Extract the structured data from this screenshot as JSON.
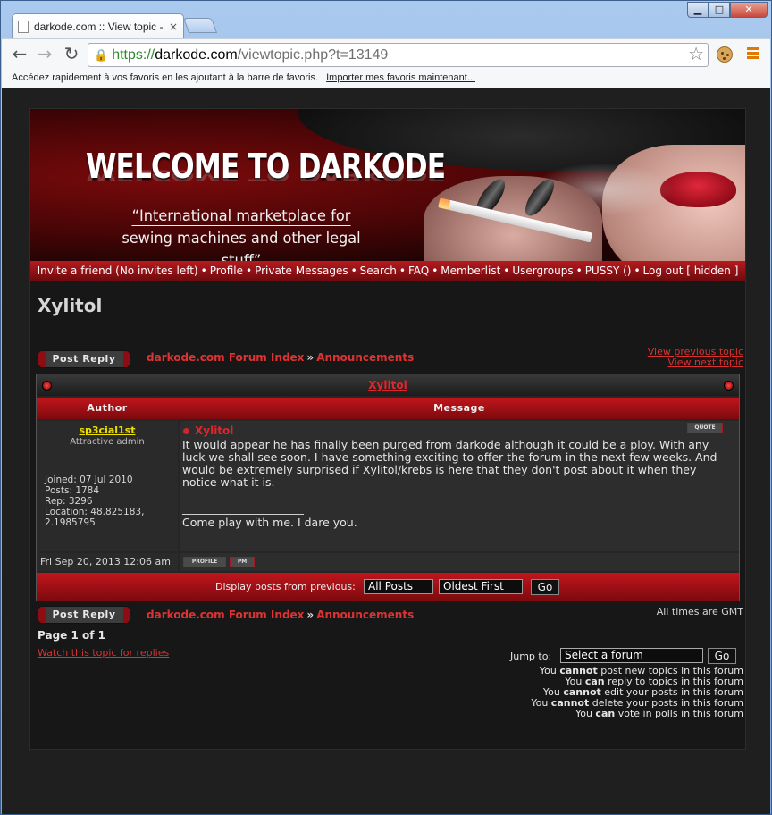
{
  "browser": {
    "tab_title": "darkode.com :: View topic - X",
    "tab_close": "×",
    "url_scheme": "https://",
    "url_host": "darkode.com",
    "url_path": "/viewtopic.php?t=13149",
    "bookmarks_bar_text": "Accédez rapidement à vos favoris en les ajoutant à la barre de favoris.",
    "bookmarks_import_link": "Importer mes favoris maintenant..."
  },
  "banner": {
    "welcome_text": "WELCOME TO DARKODE",
    "tagline_line1": "“International marketplace for",
    "tagline_line2": "sewing machines and other legal stuff”"
  },
  "topnav": {
    "items": [
      "Invite a friend (No invites left)",
      "Profile",
      "Private Messages",
      "Search",
      "FAQ",
      "Memberlist",
      "Usergroups",
      "PUSSY ()",
      "Log out [ hidden ]"
    ],
    "separator": "•"
  },
  "topic": {
    "heading": "Xylitol",
    "post_reply_label": "Post Reply",
    "breadcrumb_index": "darkode.com Forum Index",
    "breadcrumb_sep": "»",
    "breadcrumb_forum": "Announcements",
    "view_previous": "View previous topic",
    "view_next": "View next topic",
    "title_link": "Xylitol"
  },
  "table": {
    "col_author": "Author",
    "col_message": "Message"
  },
  "post": {
    "author": "sp3cial1st",
    "rank": "Attractive admin",
    "joined": "Joined: 07 Jul 2010",
    "posts": "Posts: 1784",
    "rep": "Rep: 3296",
    "location_line1": "Location: 48.825183,",
    "location_line2": "2.1985795",
    "subject": "Xylitol",
    "quote_label": "QUOTE",
    "body": "It would appear he has finally been purged from darkode although it could be a ploy. With any luck we shall see soon. I have something exciting to offer the forum in the next few weeks. And would be extremely surprised if Xylitol/krebs is here that they don't post about it when they notice what it is.",
    "signature": "Come play with me. I dare you.",
    "date": "Fri Sep 20, 2013 12:06 am",
    "profile_label": "PROFILE",
    "pm_label": "PM"
  },
  "display_bar": {
    "label": "Display posts from previous:",
    "posts_value": "All Posts",
    "order_value": "Oldest First",
    "go_label": "Go"
  },
  "footer": {
    "all_times": "All times are GMT",
    "page_of": "Page 1 of 1",
    "watch_link": "Watch this topic for replies",
    "jump_label": "Jump to:",
    "jump_value": "Select a forum",
    "go_label": "Go",
    "permissions": [
      {
        "pre": "You ",
        "verb": "cannot",
        "post": " post new topics in this forum"
      },
      {
        "pre": "You ",
        "verb": "can",
        "post": " reply to topics in this forum"
      },
      {
        "pre": "You ",
        "verb": "cannot",
        "post": " edit your posts in this forum"
      },
      {
        "pre": "You ",
        "verb": "cannot",
        "post": " delete your posts in this forum"
      },
      {
        "pre": "You ",
        "verb": "can",
        "post": " vote in polls in this forum"
      }
    ]
  }
}
